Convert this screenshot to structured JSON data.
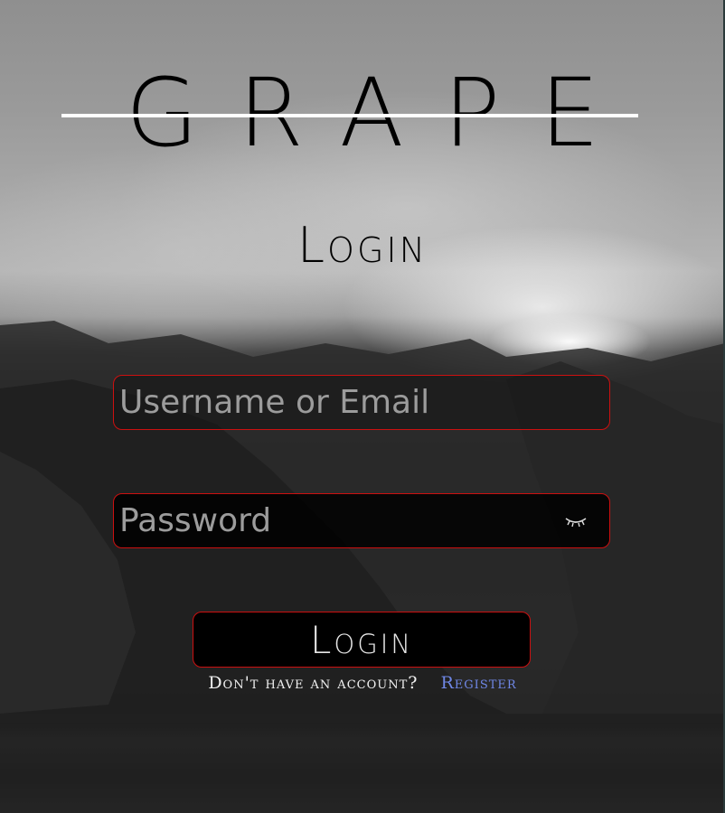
{
  "brand": {
    "name": "GRAPE"
  },
  "form": {
    "title": "Login",
    "username": {
      "placeholder": "Username or Email",
      "value": ""
    },
    "password": {
      "placeholder": "Password",
      "value": "",
      "toggle_icon": "eye-closed-icon"
    },
    "submit_label": "Login",
    "signup_prompt": "Don't have an account?",
    "register_label": "Register"
  },
  "colors": {
    "field_border": "#cc1010",
    "link": "#6f87e6",
    "title": "#000000"
  }
}
